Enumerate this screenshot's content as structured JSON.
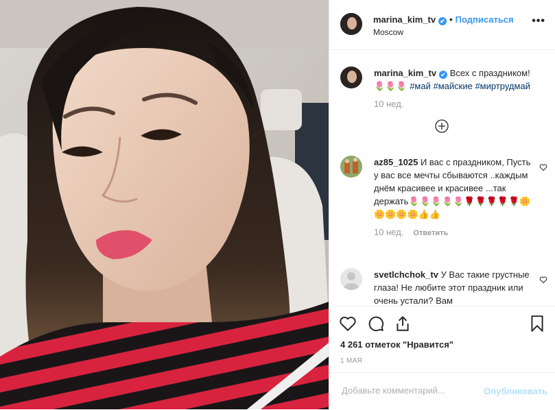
{
  "post": {
    "username": "marina_kim_tv",
    "verified_mark": "✔",
    "separator": "•",
    "follow_label": "Подписаться",
    "location": "Moscow",
    "more_label": "•••"
  },
  "caption": {
    "username": "marina_kim_tv",
    "text": "Всех с праздником!",
    "emoji": "🌷🌷🌷",
    "tags": [
      "#май",
      "#майские",
      "#миртрудмай"
    ],
    "time": "10 нед."
  },
  "comments": [
    {
      "username": "az85_1025",
      "text": "И вас с праздником, Пусть у вас все мечты сбываются ..каждым днём красивее и красивее ...так держать🌷🌷🌷🌷🌷🌹🌹🌹🌹🌹🌼🌼🌼🌼🌼👍👍",
      "time": "10 нед.",
      "reply_label": "Ответить"
    },
    {
      "username": "svetlchchok_tv",
      "text": "У Вас такие грустные глаза! Не любите этот праздник или очень устали? Вам"
    }
  ],
  "icons": {
    "load_more": "plus-circle-icon",
    "like": "heart-icon",
    "comment": "comment-icon",
    "share": "share-icon",
    "save": "bookmark-icon"
  },
  "likes_text": "4 261 отметок \"Нравится\"",
  "date_text": "1 МАЯ",
  "comment_box": {
    "placeholder": "Добавьте комментарий...",
    "publish_label": "Опубликовать"
  },
  "colors": {
    "accent": "#3897f0",
    "publish_disabled": "#b2dffc",
    "hashtag": "#003569",
    "muted": "#999999",
    "lip": "#e0506a",
    "sweater_red": "#d8233f"
  }
}
